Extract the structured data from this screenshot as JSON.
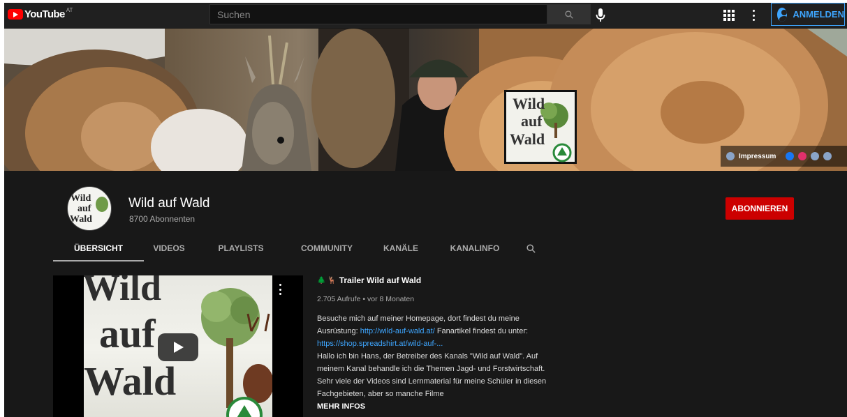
{
  "masthead": {
    "logo_text": "YouTube",
    "region": "AT",
    "search_placeholder": "Suchen",
    "signin_label": "ANMELDEN"
  },
  "banner": {
    "logo_lines": [
      "Wild",
      "auf",
      "Wald"
    ],
    "links": [
      {
        "label": "Impressum",
        "icon": "globe-icon",
        "color": "#8aa4c8"
      },
      {
        "label": "",
        "icon": "facebook-icon",
        "color": "#1877f2"
      },
      {
        "label": "",
        "icon": "instagram-icon",
        "color": "#e1306c"
      },
      {
        "label": "",
        "icon": "globe-icon",
        "color": "#8aa4c8"
      },
      {
        "label": "",
        "icon": "globe-icon",
        "color": "#8aa4c8"
      }
    ]
  },
  "channel": {
    "name": "Wild auf Wald",
    "subscribers": "8700 Abonnenten",
    "subscribe_label": "ABONNIEREN",
    "avatar_lines": [
      "Wild",
      "auf",
      "Wald"
    ]
  },
  "tabs": [
    {
      "label": "ÜBERSICHT",
      "active": true
    },
    {
      "label": "VIDEOS",
      "active": false
    },
    {
      "label": "PLAYLISTS",
      "active": false
    },
    {
      "label": "COMMUNITY",
      "active": false
    },
    {
      "label": "KANÄLE",
      "active": false
    },
    {
      "label": "KANALINFO",
      "active": false
    }
  ],
  "featured": {
    "thumb_words": [
      "Wild",
      "auf",
      "Wald"
    ],
    "title_emoji": "🌲 🦌",
    "title": "Trailer Wild auf Wald",
    "meta": "2.705 Aufrufe • vor 8 Monaten",
    "desc_1": "Besuche mich auf meiner Homepage, dort findest du meine Ausrüstung: ",
    "link_1": "http://wild-auf-wald.at/",
    "desc_2": " Fanartikel findest du unter: ",
    "link_2": "https://shop.spreadshirt.at/wild-auf-...",
    "desc_3": "Hallo ich bin Hans, der Betreiber des Kanals \"Wild auf Wald\". Auf meinem Kanal behandle ich die Themen Jagd- und Forstwirtschaft. Sehr viele der Videos sind Lernmaterial für meine Schüler in diesen Fachgebieten, aber so manche Filme",
    "more_label": "MEHR INFOS"
  },
  "colors": {
    "background": "#181818",
    "masthead": "#202020",
    "accent_blue": "#3ea6ff",
    "subscribe_red": "#cc0000"
  }
}
